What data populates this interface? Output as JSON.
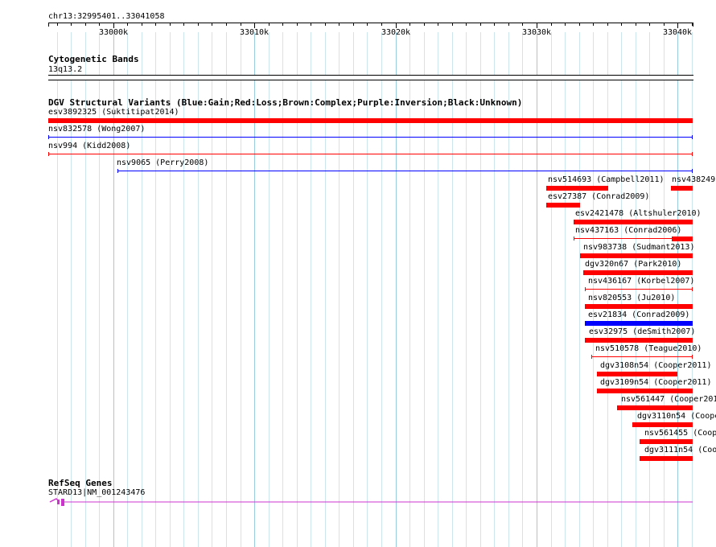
{
  "ruler": {
    "location": "chr13:32995401..33041058",
    "ticks": [
      {
        "label": "33000k",
        "pos": 33000000
      },
      {
        "label": "33010k",
        "pos": 33010000
      },
      {
        "label": "33020k",
        "pos": 33020000
      },
      {
        "label": "33030k",
        "pos": 33030000
      },
      {
        "label": "33040k",
        "pos": 33040000
      }
    ]
  },
  "cytoband": {
    "title": "Cytogenetic Bands",
    "band": "13q13.2"
  },
  "dgv": {
    "title": "DGV Structural Variants (Blue:Gain;Red:Loss;Brown:Complex;Purple:Inversion;Black:Unknown)",
    "features": [
      {
        "label": "esv3892325 (Suktitipat2014)",
        "color": "#ff0000",
        "style": "thick",
        "start": 32995401,
        "end": 33041058
      },
      {
        "label": "nsv832578 (Wong2007)",
        "color": "#0000ff",
        "style": "thin",
        "start": 32995401,
        "end": 33041058
      },
      {
        "label": "nsv994 (Kidd2008)",
        "color": "#ff0000",
        "style": "thin",
        "start": 32995401,
        "end": 33041058
      },
      {
        "label": "nsv9065 (Perry2008)",
        "color": "#0000ff",
        "style": "thin",
        "start": 33000300,
        "end": 33041058
      },
      {
        "label": "nsv514693 (Campbell2011)",
        "color": "#ff0000",
        "style": "thick",
        "start": 33030700,
        "end": 33035100
      },
      {
        "label": "nsv438249",
        "color": "#ff0000",
        "style": "thick",
        "start": 33039500,
        "end": 33041058
      },
      {
        "label": "esv27387 (Conrad2009)",
        "color": "#ff0000",
        "style": "thick",
        "start": 33030700,
        "end": 33033100
      },
      {
        "label": "esv2421478 (Altshuler2010)",
        "color": "#ff0000",
        "style": "thick",
        "start": 33032600,
        "end": 33041058
      },
      {
        "label": "nsv437163 (Conrad2006)",
        "color": "#ff0000",
        "style": "thinthick",
        "start": 33032600,
        "end": 33041058
      },
      {
        "label": "nsv983738 (Sudmant2013)",
        "color": "#ff0000",
        "style": "thick",
        "start": 33033100,
        "end": 33041058
      },
      {
        "label": "dgv320n67 (Park2010)",
        "color": "#ff0000",
        "style": "thick",
        "start": 33033300,
        "end": 33041058
      },
      {
        "label": "nsv436167 (Korbel2007)",
        "color": "#ff0000",
        "style": "thin",
        "start": 33033400,
        "end": 33041058
      },
      {
        "label": "nsv820553 (Ju2010)",
        "color": "#ff0000",
        "style": "thick",
        "start": 33033400,
        "end": 33041058
      },
      {
        "label": "esv21834 (Conrad2009)",
        "color": "#0000ff",
        "style": "thick",
        "start": 33033400,
        "end": 33041058
      },
      {
        "label": "esv32975 (deSmith2007)",
        "color": "#ff0000",
        "style": "thick",
        "start": 33033400,
        "end": 33041058
      },
      {
        "label": "nsv510578 (Teague2010)",
        "color": "#ff0000",
        "style": "thin",
        "start": 33033900,
        "end": 33041058
      },
      {
        "label": "dgv3108n54 (Cooper2011)",
        "color": "#ff0000",
        "style": "thick",
        "start": 33034300,
        "end": 33040000
      },
      {
        "label": "dgv3109n54 (Cooper2011)",
        "color": "#ff0000",
        "style": "thick",
        "start": 33034300,
        "end": 33041058
      },
      {
        "label": "nsv561447 (Cooper201",
        "color": "#ff0000",
        "style": "thick",
        "start": 33035700,
        "end": 33041058
      },
      {
        "label": "dgv3110n54 (Coope",
        "color": "#ff0000",
        "style": "thick",
        "start": 33036800,
        "end": 33041058
      },
      {
        "label": "nsv561455 (Coop",
        "color": "#ff0000",
        "style": "thick",
        "start": 33037300,
        "end": 33041058
      },
      {
        "label": "dgv3111n54 (Coo",
        "color": "#ff0000",
        "style": "thick",
        "start": 33037300,
        "end": 33041058
      }
    ]
  },
  "refseq": {
    "title": "RefSeq Genes",
    "gene_label": "STARD13|NM_001243476",
    "color": "#cc33cc"
  }
}
